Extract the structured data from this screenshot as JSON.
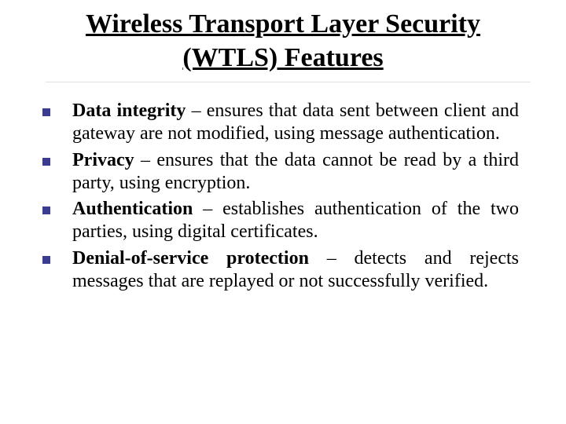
{
  "title": "Wireless Transport Layer Security (WTLS) Features",
  "items": [
    {
      "term": "Data integrity",
      "desc": " – ensures that data sent between client and gateway are not modified, using message authentication."
    },
    {
      "term": "Privacy",
      "desc": " – ensures that the data cannot be read by a third party, using encryption."
    },
    {
      "term": "Authentication",
      "desc": " – establishes authentication of the two parties, using digital certificates."
    },
    {
      "term": "Denial-of-service protection",
      "desc": " – detects and rejects messages that are replayed or not successfully verified."
    }
  ]
}
